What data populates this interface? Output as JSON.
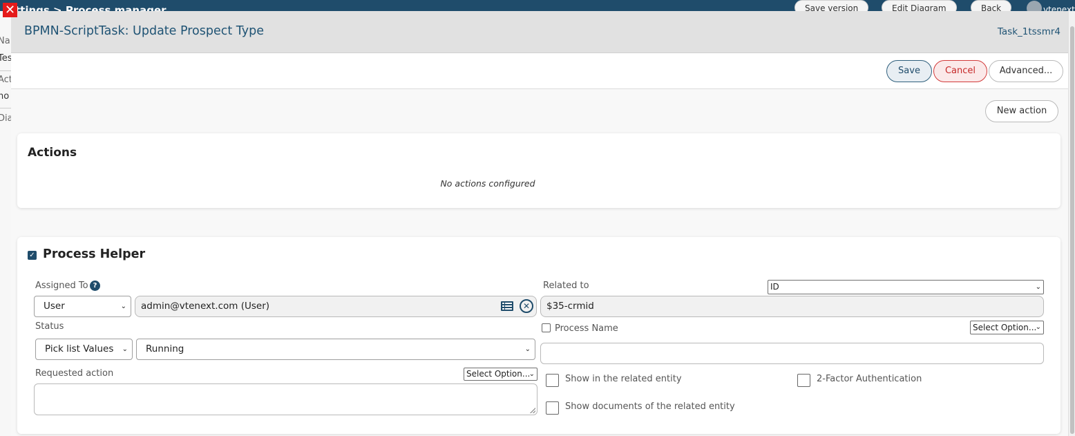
{
  "background": {
    "breadcrumb": "ttings > Process manager",
    "buttons": {
      "save_version": "Save version",
      "edit_diagram": "Edit Diagram",
      "back": "Back"
    },
    "user": "vtenext",
    "side_labels": [
      "Na",
      "Tes",
      "Act",
      "no",
      "Dia"
    ]
  },
  "modal": {
    "title": "BPMN-ScriptTask: Update Prospect Type",
    "task_id": "Task_1tssmr4",
    "toolbar": {
      "save": "Save",
      "cancel": "Cancel",
      "advanced": "Advanced..."
    },
    "new_action": "New action",
    "actions": {
      "title": "Actions",
      "empty_text": "No actions configured"
    },
    "helper": {
      "title": "Process Helper",
      "enabled": true,
      "assigned_to": {
        "label": "Assigned To",
        "type": "User",
        "value": "admin@vtenext.com (User)"
      },
      "status": {
        "label": "Status",
        "type": "Pick list Values",
        "value": "Running"
      },
      "requested_action": {
        "label": "Requested action",
        "select": "Select Option...",
        "value": ""
      },
      "related_to": {
        "label": "Related to",
        "select": "ID",
        "value": "$35-crmid"
      },
      "process_name": {
        "label": "Process Name",
        "checked": false,
        "select": "Select Option...",
        "value": ""
      },
      "show_in_related_entity": {
        "label": "Show in the related entity",
        "checked": false
      },
      "two_factor": {
        "label": "2-Factor Authentication",
        "checked": false
      },
      "show_documents": {
        "label": "Show documents of the related entity",
        "checked": false
      }
    }
  },
  "colors": {
    "accent": "#1f4c6b",
    "cancel": "#c62828",
    "close": "#e51b1b"
  }
}
